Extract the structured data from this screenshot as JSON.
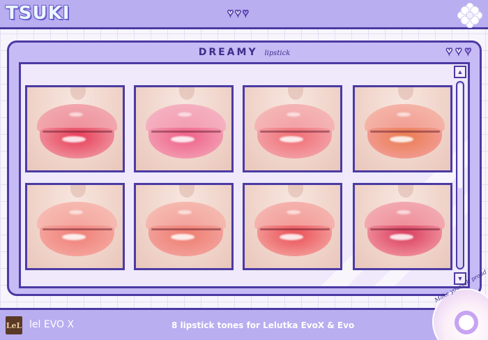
{
  "header": {
    "logo_text": "TSUKI",
    "hearts": [
      "outline",
      "outline",
      "filled"
    ]
  },
  "window": {
    "title": "DREAMY",
    "subtitle": "lipstick",
    "hearts": [
      "outline",
      "outline",
      "filled"
    ]
  },
  "swatches": [
    {
      "name": "tone-1",
      "upper": "#ef8f9b",
      "lower": "#e73a55",
      "upper_edge": "#f1a6ad"
    },
    {
      "name": "tone-2",
      "upper": "#f39bb0",
      "lower": "#ee5f88",
      "upper_edge": "#f4b0c0"
    },
    {
      "name": "tone-3",
      "upper": "#f3a0a6",
      "lower": "#ef6c72",
      "upper_edge": "#f4b5b4"
    },
    {
      "name": "tone-4",
      "upper": "#f29b92",
      "lower": "#ea7a4d",
      "upper_edge": "#f4b3a6"
    },
    {
      "name": "tone-5",
      "upper": "#f4a49c",
      "lower": "#f07f78",
      "upper_edge": "#f6b9b0"
    },
    {
      "name": "tone-6",
      "upper": "#f2a09a",
      "lower": "#ef7c6e",
      "upper_edge": "#f5b8ae"
    },
    {
      "name": "tone-7",
      "upper": "#f39a97",
      "lower": "#ea4e55",
      "upper_edge": "#f5b2ad"
    },
    {
      "name": "tone-8",
      "upper": "#ef8d9a",
      "lower": "#d93b5e",
      "upper_edge": "#f2a8b0"
    }
  ],
  "footer": {
    "brand_logo": "LeL",
    "brand_text": "lel EVO X",
    "caption": "8 lipstick tones for Lelutka EvoX & Evo",
    "badge_text": "Make yourself proud"
  },
  "colors": {
    "accent": "#4b3aa3",
    "bar_bg": "#b9aef0",
    "window_bg": "#c6bbf5",
    "content_bg": "#efe9fb"
  }
}
